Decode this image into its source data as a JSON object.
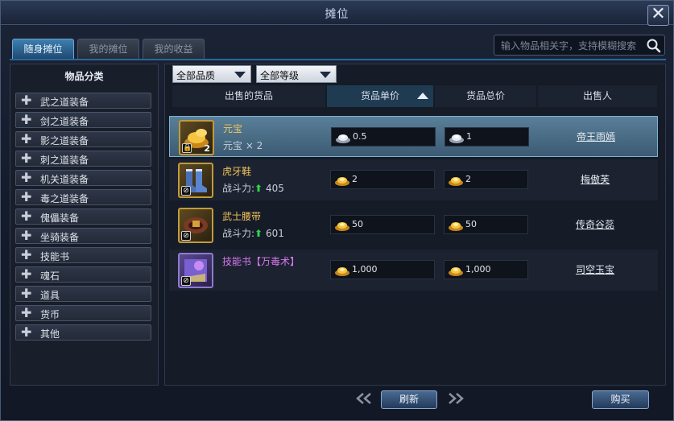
{
  "window": {
    "title": "摊位"
  },
  "tabs": [
    {
      "label": "随身摊位",
      "active": true
    },
    {
      "label": "我的摊位",
      "active": false
    },
    {
      "label": "我的收益",
      "active": false
    }
  ],
  "search": {
    "placeholder": "输入物品相关字，支持模糊搜索"
  },
  "sidebar": {
    "header": "物品分类",
    "items": [
      {
        "label": "武之道装备"
      },
      {
        "label": "剑之道装备"
      },
      {
        "label": "影之道装备"
      },
      {
        "label": "刺之道装备"
      },
      {
        "label": "机关道装备"
      },
      {
        "label": "毒之道装备"
      },
      {
        "label": "傀儡装备"
      },
      {
        "label": "坐骑装备"
      },
      {
        "label": "技能书"
      },
      {
        "label": "魂石"
      },
      {
        "label": "道具"
      },
      {
        "label": "货币"
      },
      {
        "label": "其他"
      }
    ]
  },
  "filters": {
    "quality": "全部品质",
    "level": "全部等级"
  },
  "columns": {
    "item": "出售的货品",
    "unit_price": "货品单价",
    "total_price": "货品总价",
    "seller": "出售人"
  },
  "rows": [
    {
      "name": "元宝",
      "name_color": "#f2c95a",
      "sub": "元宝 × 2",
      "qty": "2",
      "unit_price": "0.5",
      "total_price": "1",
      "currency": "silver",
      "seller": "帝王雨嫣",
      "icon": "gold-ingot-icon",
      "selected": true
    },
    {
      "name": "虎牙鞋",
      "name_color": "#f0c25a",
      "power_label": "战斗力:",
      "power": "405",
      "unit_price": "2",
      "total_price": "2",
      "currency": "gold",
      "seller": "梅傲芙",
      "icon": "boots-icon"
    },
    {
      "name": "武士腰带",
      "name_color": "#f0c25a",
      "power_label": "战斗力:",
      "power": "601",
      "unit_price": "50",
      "total_price": "50",
      "currency": "gold",
      "seller": "传奇谷蕊",
      "icon": "belt-icon"
    },
    {
      "name": "技能书【万毒术】",
      "name_color": "#d778f0",
      "unit_price": "1,000",
      "total_price": "1,000",
      "currency": "gold",
      "seller": "司空玉宝",
      "icon": "skill-book-icon"
    }
  ],
  "footer": {
    "refresh": "刷新",
    "buy": "购买"
  }
}
